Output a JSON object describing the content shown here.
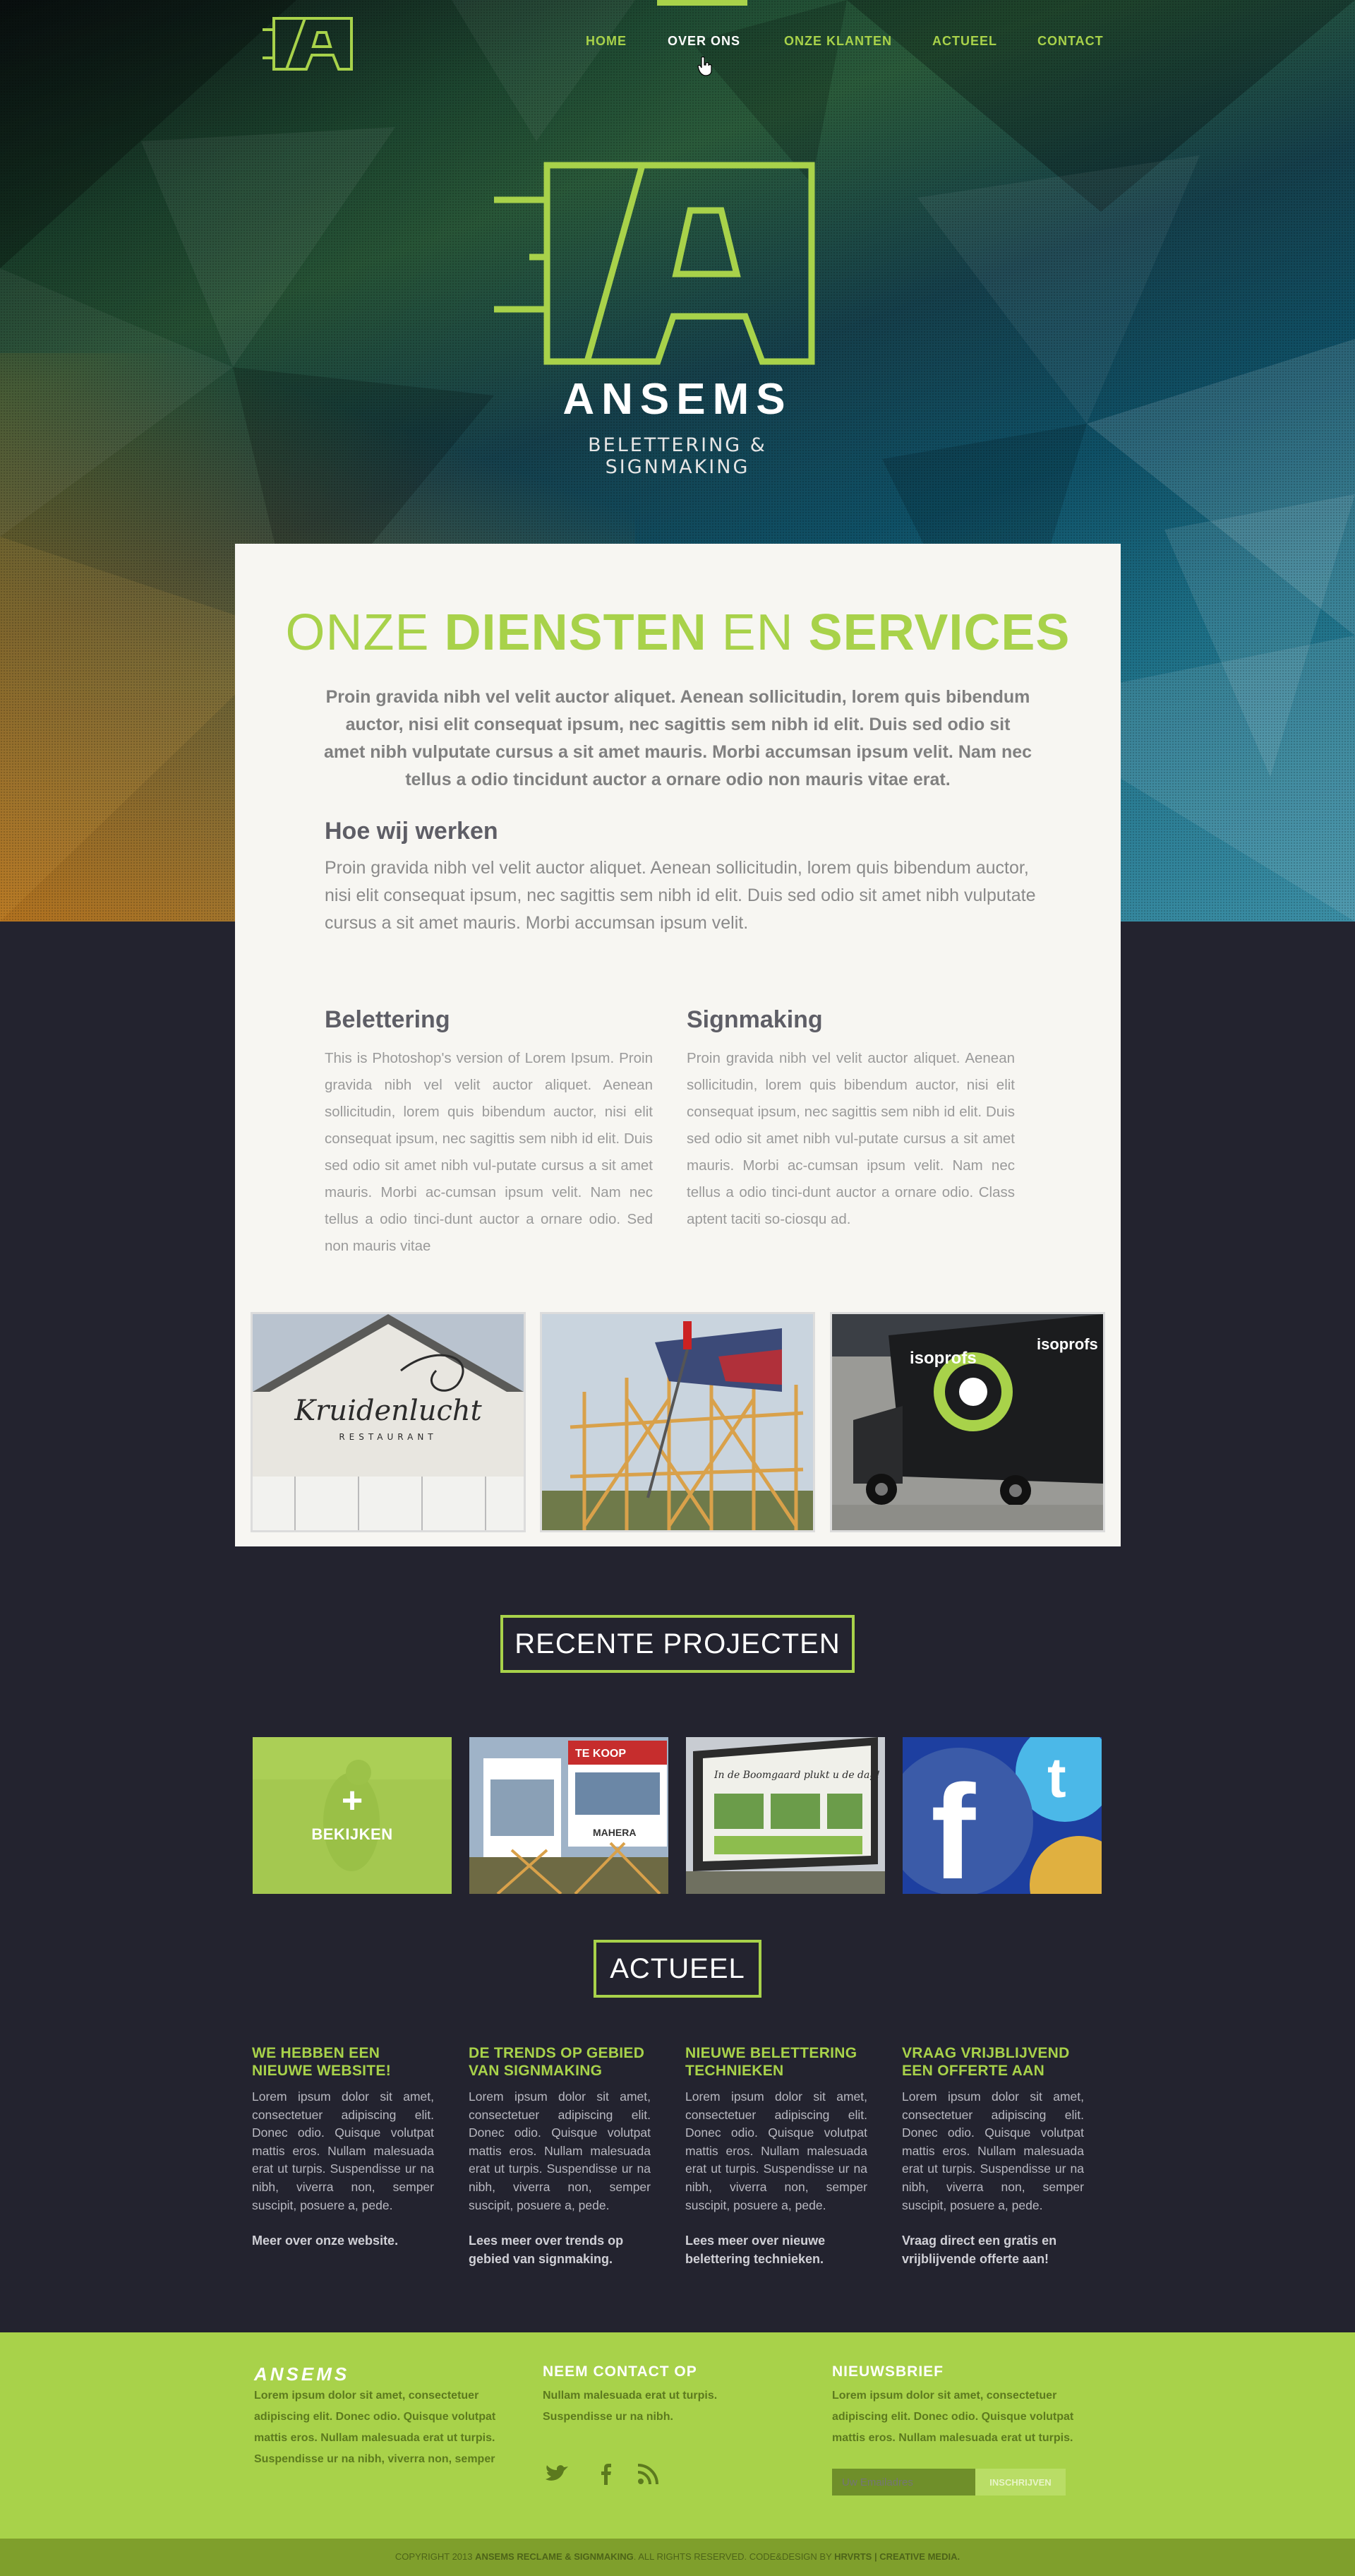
{
  "nav": {
    "items": [
      {
        "label": "HOME"
      },
      {
        "label": "OVER ONS"
      },
      {
        "label": "ONZE KLANTEN"
      },
      {
        "label": "ACTUEEL"
      },
      {
        "label": "CONTACT"
      }
    ],
    "active": "OVER ONS"
  },
  "hero": {
    "brand": "ANSEMS",
    "tagline": "BELETTERING & SIGNMAKING"
  },
  "services": {
    "title_part1": "ONZE ",
    "title_part2": "DIENSTEN",
    "title_part3": " EN ",
    "title_part4": "SERVICES",
    "intro": "Proin gravida nibh vel velit auctor aliquet. Aenean sollicitudin, lorem quis bibendum auctor, nisi elit consequat ipsum, nec sagittis sem nibh id elit. Duis sed odio sit amet nibh vulputate cursus a sit amet mauris. Morbi accumsan ipsum velit. Nam nec tellus a odio tincidunt auctor a ornare odio non  mauris vitae erat.",
    "how_title": "Hoe wij werken",
    "how_text": "Proin gravida nibh vel velit auctor aliquet. Aenean sollicitudin, lorem quis bibendum auctor, nisi elit consequat ipsum, nec sagittis sem nibh id elit. Duis sed odio sit amet nibh vulputate cursus a sit amet mauris. Morbi accumsan ipsum velit.",
    "col1_title": "Belettering",
    "col1_text": "This is Photoshop's version  of Lorem Ipsum. Proin gravida nibh vel velit auctor aliquet. Aenean sollicitudin, lorem quis bibendum auctor, nisi elit consequat ipsum, nec sagittis sem nibh id elit. Duis sed odio sit amet nibh vul-putate cursus a sit amet mauris. Morbi ac-cumsan ipsum velit. Nam nec tellus a odio tinci-dunt auctor a ornare odio. Sed non  mauris vitae",
    "col2_title": "Signmaking",
    "col2_text": "Proin gravida nibh vel velit auctor aliquet. Aenean sollicitudin, lorem quis bibendum auctor, nisi elit consequat ipsum, nec sagittis sem nibh id elit. Duis sed odio sit amet nibh vul-putate cursus a sit amet mauris. Morbi ac-cumsan ipsum velit. Nam nec tellus a odio tinci-dunt auctor a ornare odio. Class aptent taciti so-ciosqu ad.",
    "photo1_sign": "Kruidenlucht",
    "photo1_sub": "RESTAURANT",
    "photo3_brand": "isoprofs"
  },
  "projects": {
    "title": "RECENTE PROJECTEN",
    "plus": "+",
    "view_label": "BEKIJKEN",
    "proj2_sign1": "TE KOOP",
    "proj2_sign2": "MAHERA",
    "proj3_sign": "In de Boomgaard plukt u de dag!"
  },
  "news": {
    "title": "ACTUEEL",
    "items": [
      {
        "title": "WE HEBBEN EEN NIEUWE WEBSITE!",
        "text": "Lorem ipsum dolor sit amet, consectetuer adipiscing elit. Donec odio. Quisque volutpat mattis eros. Nullam malesuada erat ut turpis. Suspendisse ur na nibh, viverra non, semper suscipit, posuere a, pede.",
        "more": "Meer over onze website."
      },
      {
        "title": "DE TRENDS OP GEBIED VAN SIGNMAKING",
        "text": "Lorem ipsum dolor sit amet, consectetuer adipiscing elit. Donec odio. Quisque volutpat mattis eros. Nullam malesuada erat ut turpis. Suspendisse ur na nibh, viverra non, semper suscipit, posuere a, pede.",
        "more": "Lees meer over trends op gebied van signmaking."
      },
      {
        "title": "NIEUWE BELETTERING TECHNIEKEN",
        "text": "Lorem ipsum dolor sit amet, consectetuer adipiscing elit. Donec odio. Quisque volutpat mattis eros. Nullam malesuada erat ut turpis. Suspendisse ur na nibh, viverra non, semper suscipit, posuere a, pede.",
        "more": "Lees meer over nieuwe belettering technieken."
      },
      {
        "title": "VRAAG VRIJBLIJVEND EEN OFFERTE AAN",
        "text": "Lorem ipsum dolor sit amet, consectetuer adipiscing elit. Donec odio. Quisque volutpat mattis eros. Nullam malesuada erat ut turpis. Suspendisse ur na nibh, viverra non, semper suscipit, posuere a, pede.",
        "more": "Vraag direct een gratis en vrijblijvende offerte aan!"
      }
    ]
  },
  "footer": {
    "brand": "ANSEMS",
    "brand_text": "Lorem ipsum dolor sit amet, consectetuer adipiscing elit. Donec odio. Quisque volutpat mattis eros. Nullam malesuada erat ut turpis. Suspendisse ur na nibh, viverra non, semper",
    "contact_title": "NEEM CONTACT OP",
    "contact_text": "Nullam malesuada erat ut turpis. Suspendisse ur na nibh.",
    "newsletter_title": "NIEUWSBRIEF",
    "newsletter_text": "Lorem ipsum dolor sit amet, consectetuer adipiscing elit. Donec odio. Quisque volutpat mattis eros. Nullam malesuada erat ut turpis.",
    "email_placeholder": "Uw Emailadres",
    "subscribe_label": "INSCHRIJVEN",
    "social_icons": [
      "twitter-icon",
      "facebook-icon",
      "rss-icon"
    ],
    "copyright_prefix": "COPYRIGHT 2013 ",
    "copyright_company": "ANSEMS RECLAME & SIGNMAKING",
    "copyright_mid": ". ALL RIGHTS RESERVED. CODE&DESIGN BY ",
    "copyright_credit": "HRVRTS | CREATIVE MEDIA."
  },
  "colors": {
    "accent": "#a8d24a",
    "dark_bg": "#23232f",
    "card_bg": "#f7f6f2"
  }
}
